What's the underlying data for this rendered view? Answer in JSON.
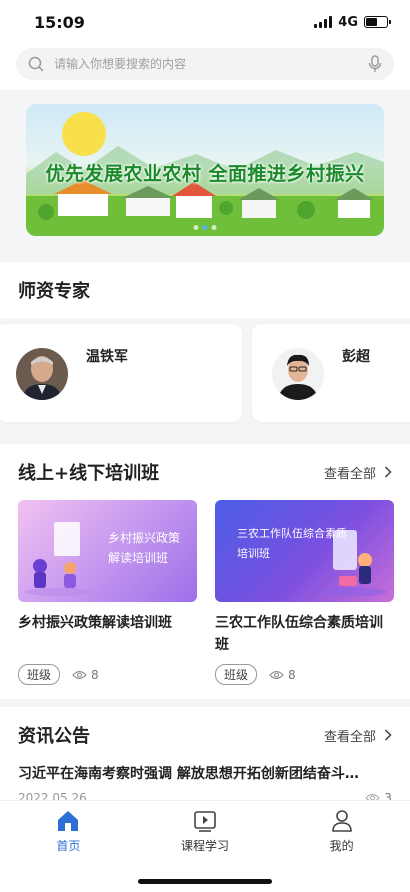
{
  "status_bar": {
    "time": "15:09",
    "network": "4G"
  },
  "search": {
    "placeholder": "请输入你想要搜索的内容"
  },
  "banner": {
    "title": "优先发展农业农村  全面推进乡村振兴",
    "dots": 3,
    "active_dot": 1
  },
  "experts": {
    "title": "师资专家",
    "items": [
      {
        "name": "温铁军"
      },
      {
        "name": "彭超"
      }
    ]
  },
  "training": {
    "title": "线上+线下培训班",
    "view_all": "查看全部",
    "courses": [
      {
        "thumb_text": [
          "乡村振兴政策",
          "解读培训班"
        ],
        "title": "乡村振兴政策解读培训班",
        "tag": "班级",
        "views": "8"
      },
      {
        "thumb_text": [
          "三农工作队伍综合素质",
          "培训班"
        ],
        "title": "三农工作队伍综合素质培训班",
        "tag": "班级",
        "views": "8"
      }
    ]
  },
  "news": {
    "title": "资讯公告",
    "view_all": "查看全部",
    "items": [
      {
        "title": "习近平在海南考察时强调 解放思想开拓创新团结奋斗…",
        "date": "2022 05 26",
        "views": "3"
      }
    ]
  },
  "tabbar": {
    "items": [
      {
        "label": "首页",
        "icon": "home-icon",
        "active": true
      },
      {
        "label": "课程学习",
        "icon": "play-icon",
        "active": false
      },
      {
        "label": "我的",
        "icon": "user-icon",
        "active": false
      }
    ]
  },
  "colors": {
    "accent": "#2d6fd6",
    "banner_green": "#1a8a2a"
  }
}
